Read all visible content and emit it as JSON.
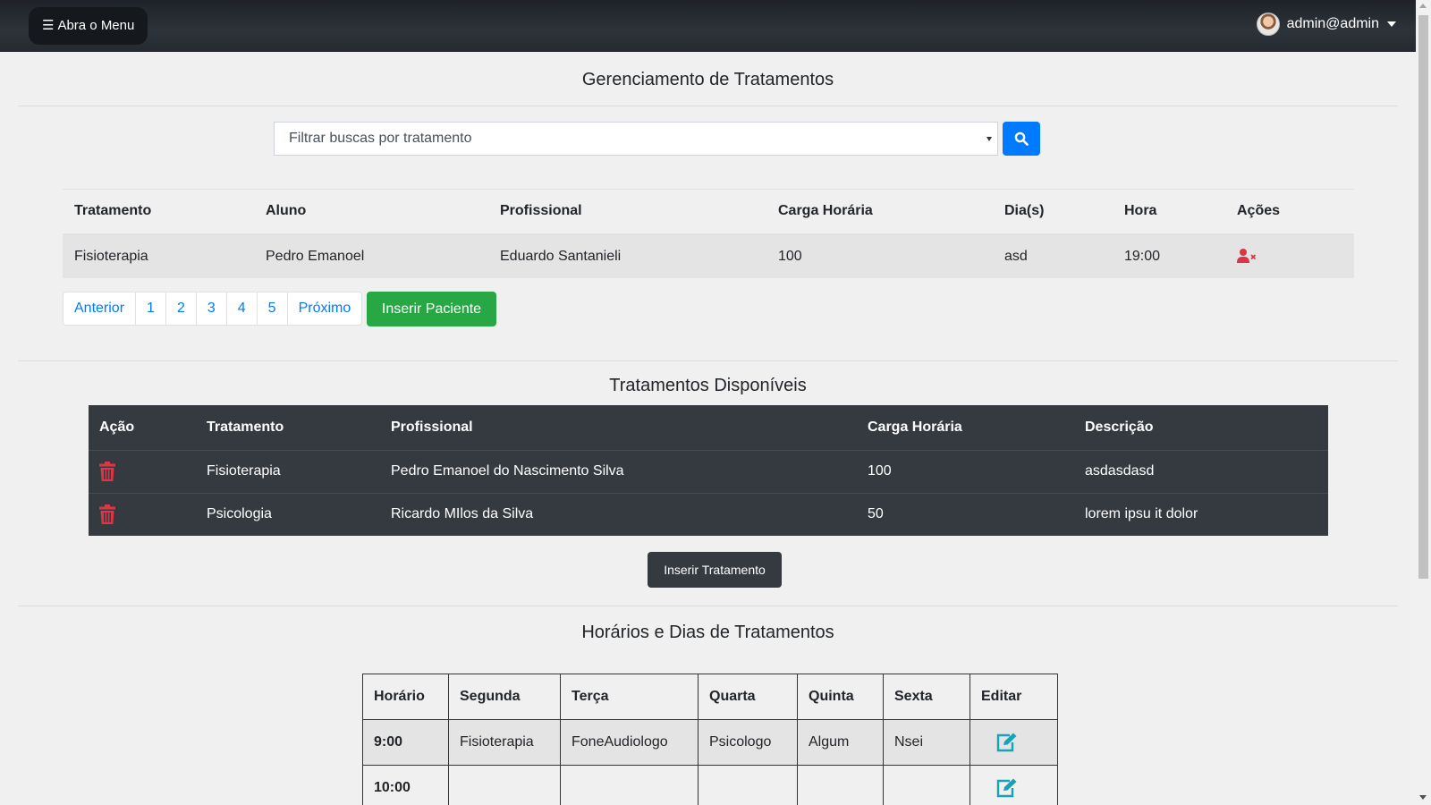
{
  "navbar": {
    "menu_icon": "☰",
    "menu_label": "Abra o Menu",
    "user_label": "admin@admin"
  },
  "section1": {
    "title": "Gerenciamento de Tratamentos",
    "filter_placeholder": "Filtrar buscas por tratamento",
    "headers": [
      "Tratamento",
      "Aluno",
      "Profissional",
      "Carga Horária",
      "Dia(s)",
      "Hora",
      "Ações"
    ],
    "rows": [
      [
        "Fisioterapia",
        "Pedro Emanoel",
        "Eduardo Santanieli",
        "100",
        "asd",
        "19:00"
      ]
    ],
    "pagination": [
      "Anterior",
      "1",
      "2",
      "3",
      "4",
      "5",
      "Próximo"
    ],
    "insert_label": "Inserir Paciente"
  },
  "section2": {
    "title": "Tratamentos Disponíveis",
    "headers": [
      "Ação",
      "Tratamento",
      "Profissional",
      "Carga Horária",
      "Descrição"
    ],
    "rows": [
      [
        "Fisioterapia",
        "Pedro Emanoel do Nascimento Silva",
        "100",
        "asdasdasd"
      ],
      [
        "Psicologia",
        "Ricardo MIlos da Silva",
        "50",
        "lorem ipsu it dolor"
      ]
    ],
    "insert_label": "Inserir Tratamento"
  },
  "section3": {
    "title": "Horários e Dias de Tratamentos",
    "headers": [
      "Horário",
      "Segunda",
      "Terça",
      "Quarta",
      "Quinta",
      "Sexta",
      "Editar"
    ],
    "rows": [
      [
        "9:00",
        "Fisioterapia",
        "FoneAudiologo",
        "Psicologo",
        "Algum",
        "Nsei"
      ],
      [
        "10:00",
        "",
        "",
        "",
        "",
        ""
      ]
    ]
  },
  "colors": {
    "primary": "#007bff",
    "success": "#28a745",
    "danger": "#dc3545",
    "dark": "#343a40",
    "info": "#17a2b8"
  }
}
